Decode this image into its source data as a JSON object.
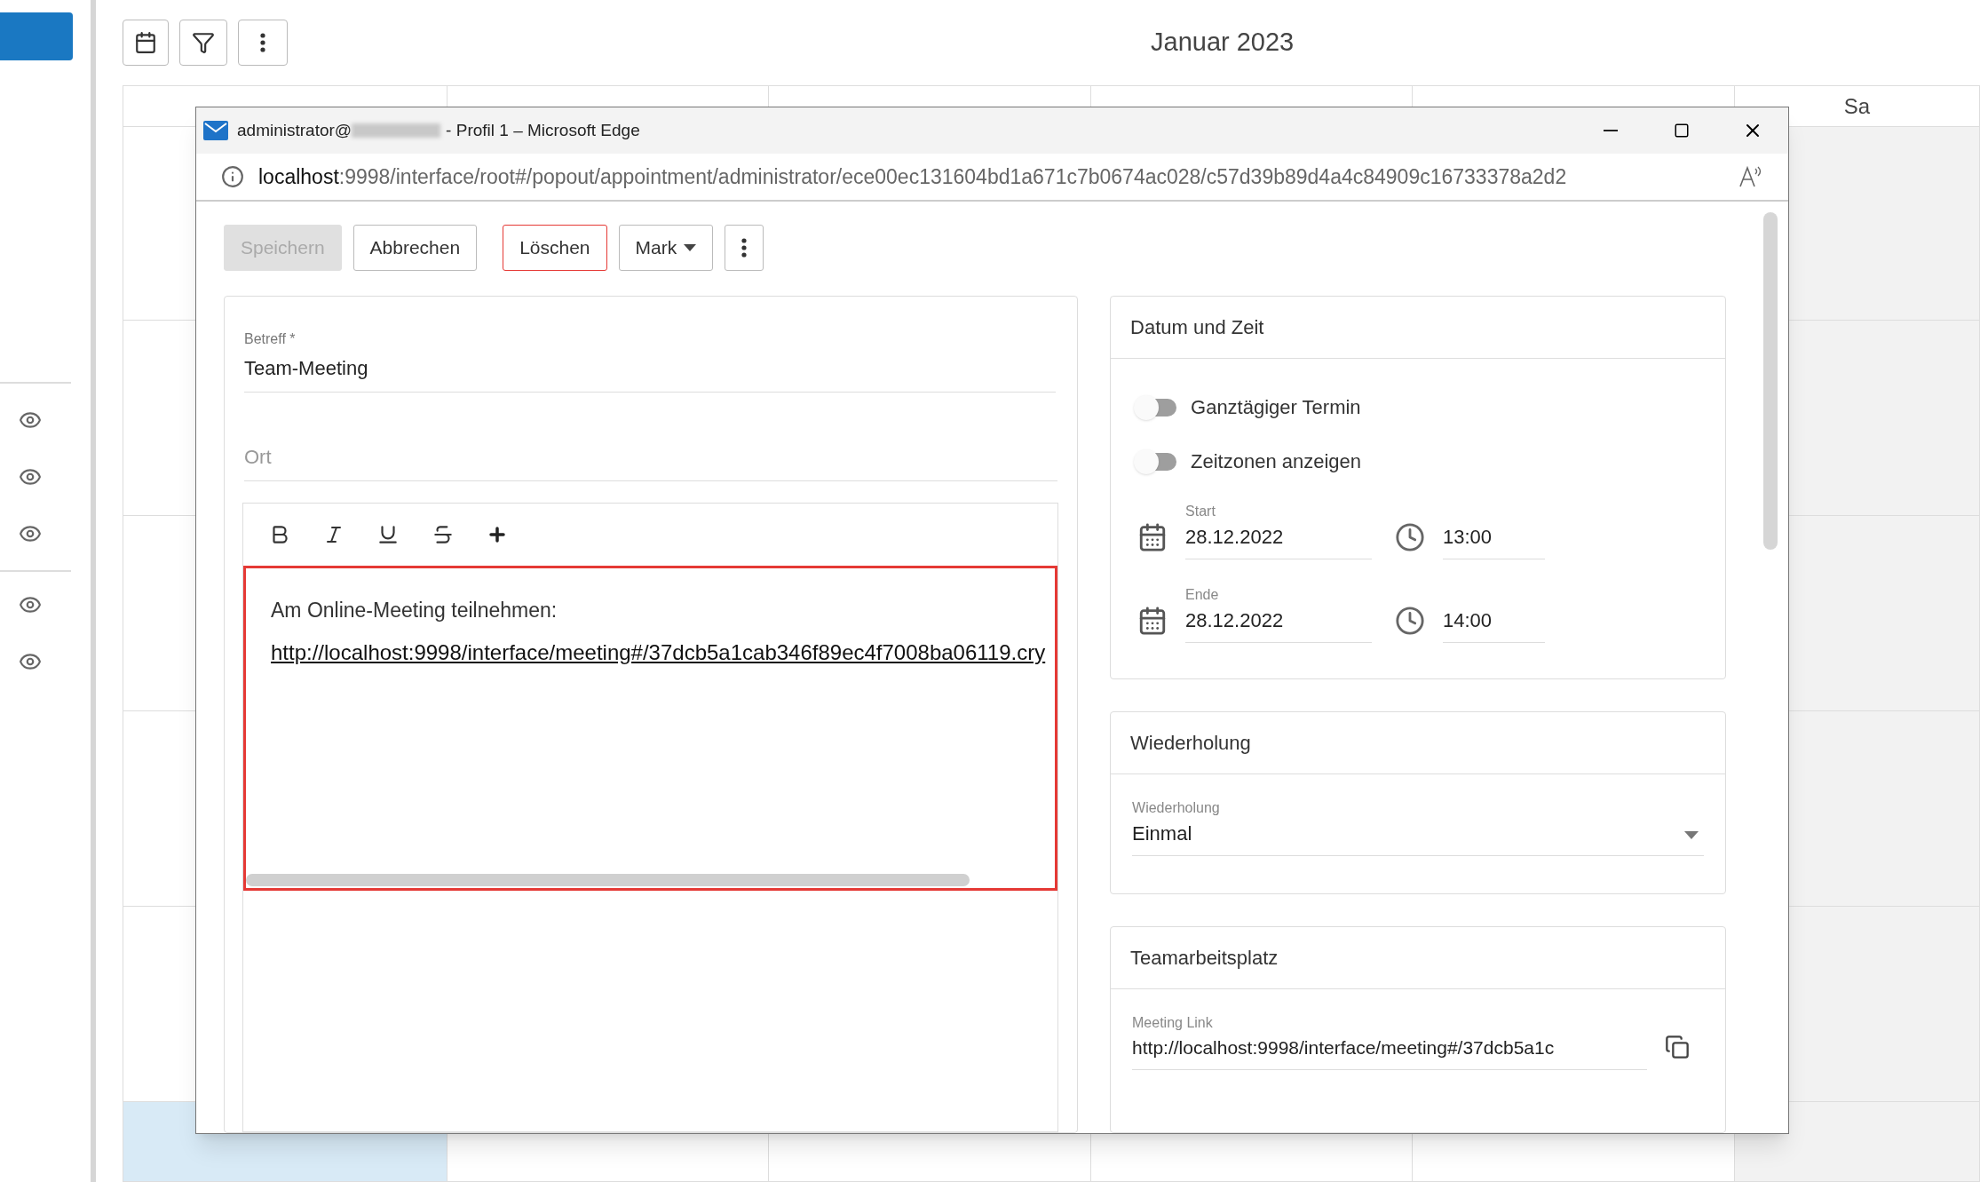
{
  "calendar": {
    "title": "Januar 2023",
    "day_headers": [
      "Sa"
    ]
  },
  "popup": {
    "title_prefix": "administrator@",
    "title_suffix": "- Profil 1 – Microsoft Edge",
    "url_host": "localhost",
    "url_path": ":9998/interface/root#/popout/appointment/administrator/ece00ec131604bd1a671c7b0674ac028/c57d39b89d4a4c84909c16733378a2d2"
  },
  "actions": [
    {
      "kind": "button",
      "label": "Speichern",
      "disabled": true
    },
    {
      "kind": "button",
      "label": "Abbrechen",
      "disabled": false
    },
    {
      "kind": "danger",
      "label": "Löschen",
      "disabled": false
    },
    {
      "kind": "dropdown",
      "label": "Mark",
      "disabled": false
    },
    {
      "kind": "more",
      "disabled": false
    }
  ],
  "form": {
    "subject": {
      "label": "Betreff *",
      "value": "Team-Meeting"
    },
    "location": {
      "placeholder": "Ort"
    },
    "editor": {
      "text": "Am Online-Meeting teilnehmen:",
      "link": "http://localhost:9998/interface/meeting#/37dcb5a1cab346f89ec4f7008ba06119.cry"
    }
  },
  "datetime": {
    "title": "Datum und Zeit",
    "toggles": [
      {
        "label": "Ganztägiger Termin",
        "on": false
      },
      {
        "label": "Zeitzonen anzeigen",
        "on": false
      }
    ],
    "start": {
      "label": "Start",
      "date": "28.12.2022",
      "time": "13:00"
    },
    "end": {
      "label": "Ende",
      "date": "28.12.2022",
      "time": "14:00"
    }
  },
  "recurrence": {
    "title": "Wiederholung",
    "label": "Wiederholung",
    "value": "Einmal"
  },
  "team": {
    "title": "Teamarbeitsplatz",
    "label": "Meeting Link",
    "value": "http://localhost:9998/interface/meeting#/37dcb5a1c"
  }
}
